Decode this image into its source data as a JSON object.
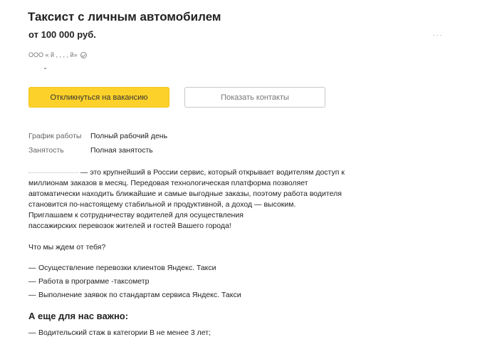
{
  "vacancy": {
    "title": "Таксист с личным автомобилем",
    "salary": "от 100 000 руб.",
    "corner_mark": "·  ·  ·",
    "employer_name": "ООО «              й         ,  ,   ,  ,  й»"
  },
  "actions": {
    "respond_label": "Откликнуться на вакансию",
    "contacts_label": "Показать контакты"
  },
  "properties": [
    {
      "key": "График работы",
      "value": "Полный рабочий день"
    },
    {
      "key": "Занятость",
      "value": "Полная занятость"
    }
  ],
  "description": {
    "intro_rest": " — это крупнейший в России сервис, который открывает водителям доступ к миллионам заказов в месяц. Передовая технологическая платформа позволяет автоматически находить ближайшие и самые выгодные заказы, поэтому работа водителя становится по-настоящему стабильной и продуктивной, а доход — высоким.",
    "invite_line1": "Приглашаем к сотрудничеству водителей для осуществления",
    "invite_line2": "пассажирских перевозок жителей и гостей Вашего города!"
  },
  "expectations": {
    "question": "Что мы ждем от тебя?",
    "items": [
      "Осуществление перевозки клиентов Яндекс. Такси",
      "Работа в программе -таксометр",
      "Выполнение заявок по стандартам сервиса Яндекс. Такси"
    ]
  },
  "requirements": {
    "title": "А еще для нас важно:",
    "items": [
      "Водительский стаж в категории В не менее 3 лет;"
    ]
  },
  "colors": {
    "accent": "#fcd12a",
    "text": "#222222",
    "muted": "#666666"
  }
}
